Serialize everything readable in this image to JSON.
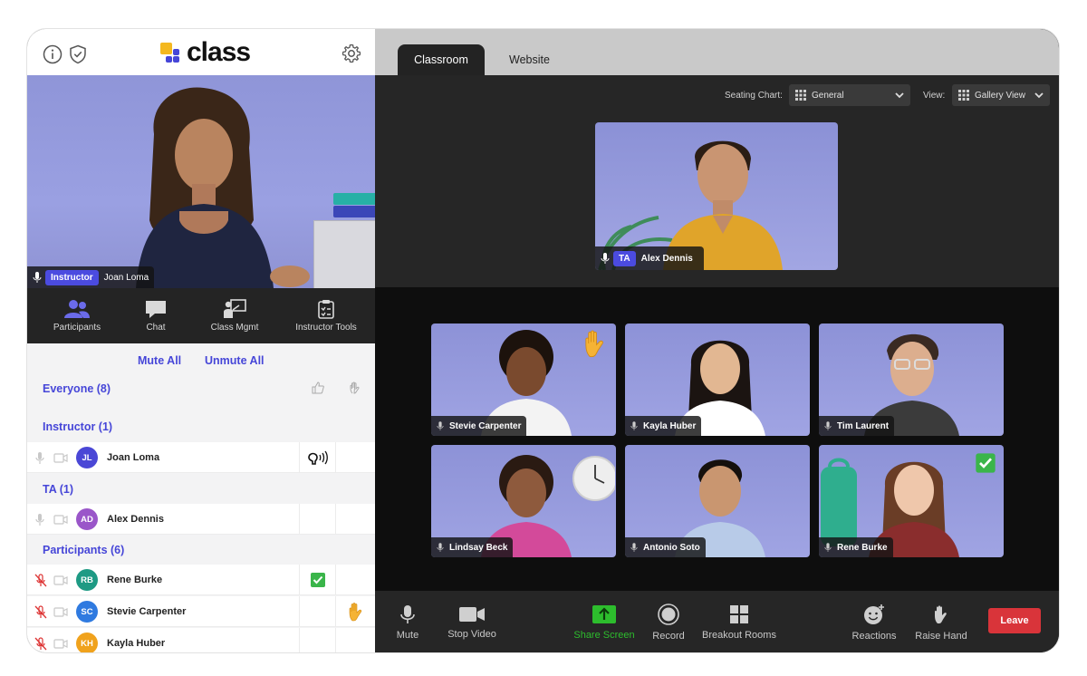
{
  "app": {
    "brand": "class"
  },
  "left": {
    "instructor_feed": {
      "role": "Instructor",
      "name": "Joan Loma"
    },
    "tabs": [
      {
        "label": "Participants",
        "icon": "participants-icon"
      },
      {
        "label": "Chat",
        "icon": "chat-icon"
      },
      {
        "label": "Class Mgmt",
        "icon": "class-mgmt-icon"
      },
      {
        "label": "Instructor Tools",
        "icon": "clipboard-icon"
      }
    ],
    "mute_all": "Mute All",
    "unmute_all": "Unmute All",
    "everyone": "Everyone (8)",
    "sections": {
      "instructor": "Instructor (1)",
      "ta": "TA (1)",
      "participants": "Participants (6)"
    },
    "rows": [
      {
        "initials": "JL",
        "name": "Joan Loma",
        "color": "#4a47d6",
        "mic": "on",
        "status": "speaking-icon"
      },
      {
        "initials": "AD",
        "name": "Alex Dennis",
        "color": "#9a56c9",
        "mic": "on",
        "status": ""
      },
      {
        "initials": "RB",
        "name": "Rene Burke",
        "color": "#1e9a84",
        "mic": "muted",
        "status": "check-icon"
      },
      {
        "initials": "SC",
        "name": "Stevie Carpenter",
        "color": "#2f7ae0",
        "mic": "muted",
        "status": "raised-hand-icon"
      },
      {
        "initials": "KH",
        "name": "Kayla Huber",
        "color": "#f0a21c",
        "mic": "muted",
        "status": ""
      }
    ]
  },
  "right": {
    "tabs": [
      "Classroom",
      "Website"
    ],
    "seating_label": "Seating Chart:",
    "seating_value": "General",
    "view_label": "View:",
    "view_value": "Gallery View",
    "ta_feed": {
      "role": "TA",
      "name": "Alex Dennis"
    },
    "gallery": [
      {
        "name": "Stevie Carpenter",
        "badge": "raised-hand-icon"
      },
      {
        "name": "Kayla Huber",
        "badge": ""
      },
      {
        "name": "Tim Laurent",
        "badge": ""
      },
      {
        "name": "Lindsay Beck",
        "badge": ""
      },
      {
        "name": "Antonio Soto",
        "badge": ""
      },
      {
        "name": "Rene Burke",
        "badge": "check-icon"
      }
    ],
    "toolbar": {
      "mute": "Mute",
      "stop_video": "Stop Video",
      "share_screen": "Share Screen",
      "record": "Record",
      "breakout": "Breakout Rooms",
      "reactions": "Reactions",
      "raise_hand": "Raise Hand",
      "leave": "Leave"
    }
  },
  "colors": {
    "accent": "#4646d8",
    "share_green": "#2dbd2d",
    "leave_red": "#d9343a"
  }
}
